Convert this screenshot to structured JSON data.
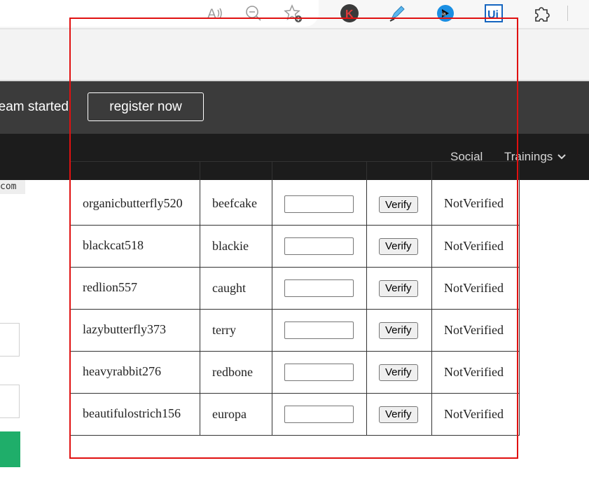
{
  "browser": {
    "icons": [
      {
        "name": "read-aloud-icon",
        "glyph": "A"
      },
      {
        "name": "zoom-out-icon",
        "glyph": "−"
      },
      {
        "name": "favorites-icon",
        "glyph": "☆"
      },
      {
        "name": "k-extension-icon",
        "glyph": "K"
      },
      {
        "name": "highlighter-extension-icon",
        "glyph": "✎"
      },
      {
        "name": "ia-extension-icon",
        "glyph": "ia"
      },
      {
        "name": "ui-extension-icon",
        "glyph": "Ui"
      },
      {
        "name": "extensions-puzzle-icon",
        "glyph": "✲"
      }
    ]
  },
  "banner": {
    "text": "eam started",
    "register_label": "register now"
  },
  "nav": {
    "social_label": "Social",
    "trainings_label": "Trainings"
  },
  "left_fragment": {
    "text": "com"
  },
  "table": {
    "verify_label": "Verify",
    "rows": [
      {
        "username": "organicbutterfly520",
        "password": "beefcake",
        "code": "",
        "status": "NotVerified"
      },
      {
        "username": "blackcat518",
        "password": "blackie",
        "code": "",
        "status": "NotVerified"
      },
      {
        "username": "redlion557",
        "password": "caught",
        "code": "",
        "status": "NotVerified"
      },
      {
        "username": "lazybutterfly373",
        "password": "terry",
        "code": "",
        "status": "NotVerified"
      },
      {
        "username": "heavyrabbit276",
        "password": "redbone",
        "code": "",
        "status": "NotVerified"
      },
      {
        "username": "beautifulostrich156",
        "password": "europa",
        "code": "",
        "status": "NotVerified"
      }
    ]
  },
  "colors": {
    "banner_bg": "#3b3b3b",
    "nav_bg": "#1c1c1c",
    "frame_red": "#e01010",
    "green_button": "#1fae6a"
  }
}
